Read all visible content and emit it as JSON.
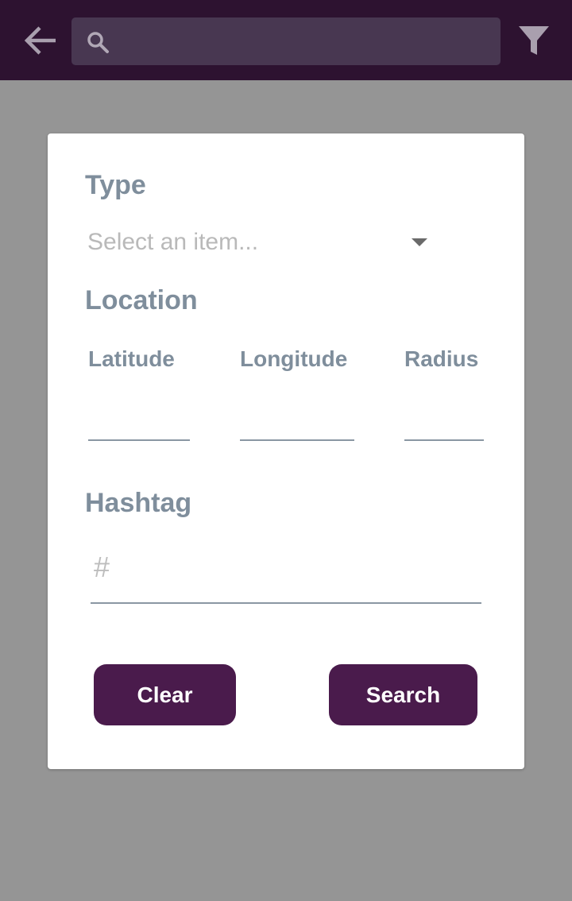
{
  "topbar": {
    "back_icon": "arrow-left-icon",
    "search_icon": "magnifier-icon",
    "search_value": "",
    "filter_icon": "funnel-icon",
    "background_color": "#2d1230",
    "search_background": "#483751"
  },
  "form": {
    "type_label": "Type",
    "type_placeholder": "Select an item...",
    "location_label": "Location",
    "latitude_label": "Latitude",
    "latitude_value": "",
    "longitude_label": "Longitude",
    "longitude_value": "",
    "radius_label": "Radius",
    "radius_value": "",
    "hashtag_label": "Hashtag",
    "hashtag_icon": "#",
    "hashtag_value": ""
  },
  "actions": {
    "clear_label": "Clear",
    "search_label": "Search",
    "button_color": "#4a1b4c"
  }
}
